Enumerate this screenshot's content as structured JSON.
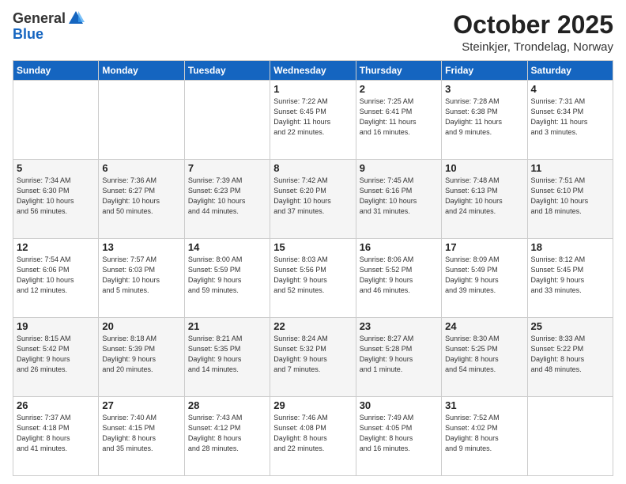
{
  "header": {
    "logo_general": "General",
    "logo_blue": "Blue",
    "month": "October 2025",
    "location": "Steinkjer, Trondelag, Norway"
  },
  "days_of_week": [
    "Sunday",
    "Monday",
    "Tuesday",
    "Wednesday",
    "Thursday",
    "Friday",
    "Saturday"
  ],
  "weeks": [
    [
      {
        "day": "",
        "info": ""
      },
      {
        "day": "",
        "info": ""
      },
      {
        "day": "",
        "info": ""
      },
      {
        "day": "1",
        "info": "Sunrise: 7:22 AM\nSunset: 6:45 PM\nDaylight: 11 hours\nand 22 minutes."
      },
      {
        "day": "2",
        "info": "Sunrise: 7:25 AM\nSunset: 6:41 PM\nDaylight: 11 hours\nand 16 minutes."
      },
      {
        "day": "3",
        "info": "Sunrise: 7:28 AM\nSunset: 6:38 PM\nDaylight: 11 hours\nand 9 minutes."
      },
      {
        "day": "4",
        "info": "Sunrise: 7:31 AM\nSunset: 6:34 PM\nDaylight: 11 hours\nand 3 minutes."
      }
    ],
    [
      {
        "day": "5",
        "info": "Sunrise: 7:34 AM\nSunset: 6:30 PM\nDaylight: 10 hours\nand 56 minutes."
      },
      {
        "day": "6",
        "info": "Sunrise: 7:36 AM\nSunset: 6:27 PM\nDaylight: 10 hours\nand 50 minutes."
      },
      {
        "day": "7",
        "info": "Sunrise: 7:39 AM\nSunset: 6:23 PM\nDaylight: 10 hours\nand 44 minutes."
      },
      {
        "day": "8",
        "info": "Sunrise: 7:42 AM\nSunset: 6:20 PM\nDaylight: 10 hours\nand 37 minutes."
      },
      {
        "day": "9",
        "info": "Sunrise: 7:45 AM\nSunset: 6:16 PM\nDaylight: 10 hours\nand 31 minutes."
      },
      {
        "day": "10",
        "info": "Sunrise: 7:48 AM\nSunset: 6:13 PM\nDaylight: 10 hours\nand 24 minutes."
      },
      {
        "day": "11",
        "info": "Sunrise: 7:51 AM\nSunset: 6:10 PM\nDaylight: 10 hours\nand 18 minutes."
      }
    ],
    [
      {
        "day": "12",
        "info": "Sunrise: 7:54 AM\nSunset: 6:06 PM\nDaylight: 10 hours\nand 12 minutes."
      },
      {
        "day": "13",
        "info": "Sunrise: 7:57 AM\nSunset: 6:03 PM\nDaylight: 10 hours\nand 5 minutes."
      },
      {
        "day": "14",
        "info": "Sunrise: 8:00 AM\nSunset: 5:59 PM\nDaylight: 9 hours\nand 59 minutes."
      },
      {
        "day": "15",
        "info": "Sunrise: 8:03 AM\nSunset: 5:56 PM\nDaylight: 9 hours\nand 52 minutes."
      },
      {
        "day": "16",
        "info": "Sunrise: 8:06 AM\nSunset: 5:52 PM\nDaylight: 9 hours\nand 46 minutes."
      },
      {
        "day": "17",
        "info": "Sunrise: 8:09 AM\nSunset: 5:49 PM\nDaylight: 9 hours\nand 39 minutes."
      },
      {
        "day": "18",
        "info": "Sunrise: 8:12 AM\nSunset: 5:45 PM\nDaylight: 9 hours\nand 33 minutes."
      }
    ],
    [
      {
        "day": "19",
        "info": "Sunrise: 8:15 AM\nSunset: 5:42 PM\nDaylight: 9 hours\nand 26 minutes."
      },
      {
        "day": "20",
        "info": "Sunrise: 8:18 AM\nSunset: 5:39 PM\nDaylight: 9 hours\nand 20 minutes."
      },
      {
        "day": "21",
        "info": "Sunrise: 8:21 AM\nSunset: 5:35 PM\nDaylight: 9 hours\nand 14 minutes."
      },
      {
        "day": "22",
        "info": "Sunrise: 8:24 AM\nSunset: 5:32 PM\nDaylight: 9 hours\nand 7 minutes."
      },
      {
        "day": "23",
        "info": "Sunrise: 8:27 AM\nSunset: 5:28 PM\nDaylight: 9 hours\nand 1 minute."
      },
      {
        "day": "24",
        "info": "Sunrise: 8:30 AM\nSunset: 5:25 PM\nDaylight: 8 hours\nand 54 minutes."
      },
      {
        "day": "25",
        "info": "Sunrise: 8:33 AM\nSunset: 5:22 PM\nDaylight: 8 hours\nand 48 minutes."
      }
    ],
    [
      {
        "day": "26",
        "info": "Sunrise: 7:37 AM\nSunset: 4:18 PM\nDaylight: 8 hours\nand 41 minutes."
      },
      {
        "day": "27",
        "info": "Sunrise: 7:40 AM\nSunset: 4:15 PM\nDaylight: 8 hours\nand 35 minutes."
      },
      {
        "day": "28",
        "info": "Sunrise: 7:43 AM\nSunset: 4:12 PM\nDaylight: 8 hours\nand 28 minutes."
      },
      {
        "day": "29",
        "info": "Sunrise: 7:46 AM\nSunset: 4:08 PM\nDaylight: 8 hours\nand 22 minutes."
      },
      {
        "day": "30",
        "info": "Sunrise: 7:49 AM\nSunset: 4:05 PM\nDaylight: 8 hours\nand 16 minutes."
      },
      {
        "day": "31",
        "info": "Sunrise: 7:52 AM\nSunset: 4:02 PM\nDaylight: 8 hours\nand 9 minutes."
      },
      {
        "day": "",
        "info": ""
      }
    ]
  ]
}
